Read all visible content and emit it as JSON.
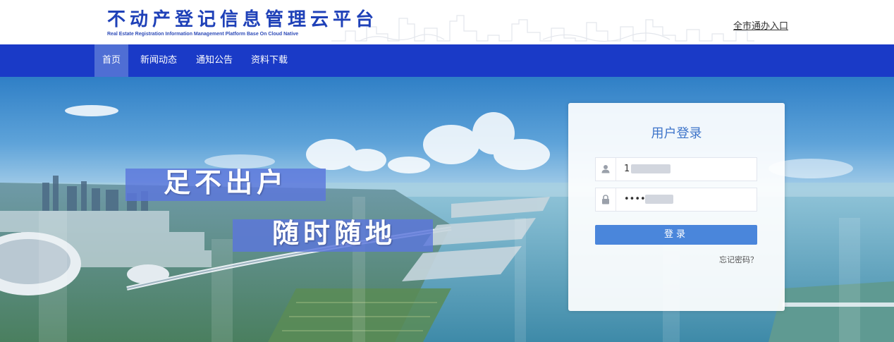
{
  "header": {
    "title": "不动产登记信息管理云平台",
    "subtitle": "Real Estate Registration Information Management Platform Base On Cloud Native",
    "city_entry_link": "全市通办入口"
  },
  "nav": {
    "items": [
      {
        "label": "首页",
        "active": true
      },
      {
        "label": "新闻动态",
        "active": false
      },
      {
        "label": "通知公告",
        "active": false
      },
      {
        "label": "资料下载",
        "active": false
      }
    ]
  },
  "banner": {
    "slogan_line1": "足不出户",
    "slogan_line2": "随时随地"
  },
  "login": {
    "title": "用户登录",
    "username_value": "1",
    "password_value": "•••••",
    "username_icon": "user-icon",
    "password_icon": "lock-icon",
    "submit_label": "登录",
    "forgot_link": "忘记密码？"
  },
  "colors": {
    "brand_blue": "#1f41b8",
    "nav_bg": "#1a3ac7",
    "nav_active": "#4f6ed4",
    "login_title": "#3d74c9",
    "login_button": "#4a86db"
  }
}
